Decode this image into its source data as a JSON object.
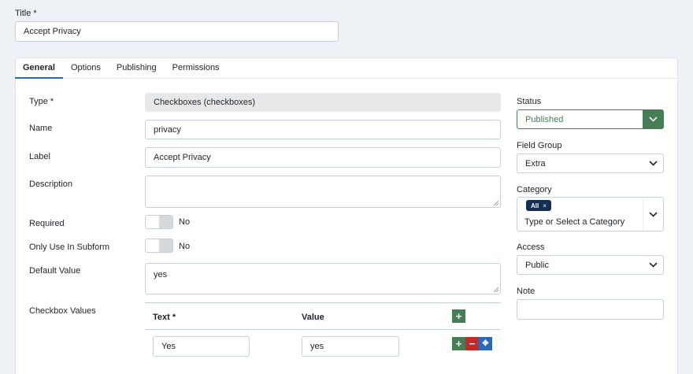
{
  "title_field": {
    "label": "Title *",
    "value": "Accept Privacy"
  },
  "tabs": [
    {
      "label": "General"
    },
    {
      "label": "Options"
    },
    {
      "label": "Publishing"
    },
    {
      "label": "Permissions"
    }
  ],
  "fields": {
    "type": {
      "label": "Type *",
      "value": "Checkboxes (checkboxes)"
    },
    "name": {
      "label": "Name",
      "value": "privacy"
    },
    "label": {
      "label": "Label",
      "value": "Accept Privacy"
    },
    "description": {
      "label": "Description",
      "value": ""
    },
    "required": {
      "label": "Required",
      "value": "No"
    },
    "only_subform": {
      "label": "Only Use In Subform",
      "value": "No"
    },
    "default_value": {
      "label": "Default Value",
      "value": "yes"
    },
    "checkbox_values": {
      "label": "Checkbox Values",
      "col_text": "Text *",
      "col_value": "Value",
      "rows": [
        {
          "text": "Yes",
          "value": "yes"
        }
      ]
    }
  },
  "sidebar": {
    "status": {
      "label": "Status",
      "value": "Published"
    },
    "field_group": {
      "label": "Field Group",
      "value": "Extra"
    },
    "category": {
      "label": "Category",
      "tag": "All",
      "tag_remove": "×",
      "placeholder": "Type or Select a Category"
    },
    "access": {
      "label": "Access",
      "value": "Public"
    },
    "note": {
      "label": "Note",
      "value": ""
    }
  },
  "icons": {
    "add": "+",
    "remove": "−",
    "move": "✥"
  },
  "colors": {
    "success": "#457d54",
    "danger": "#c52827",
    "primary": "#2a69b8",
    "tag": "#132f53"
  }
}
